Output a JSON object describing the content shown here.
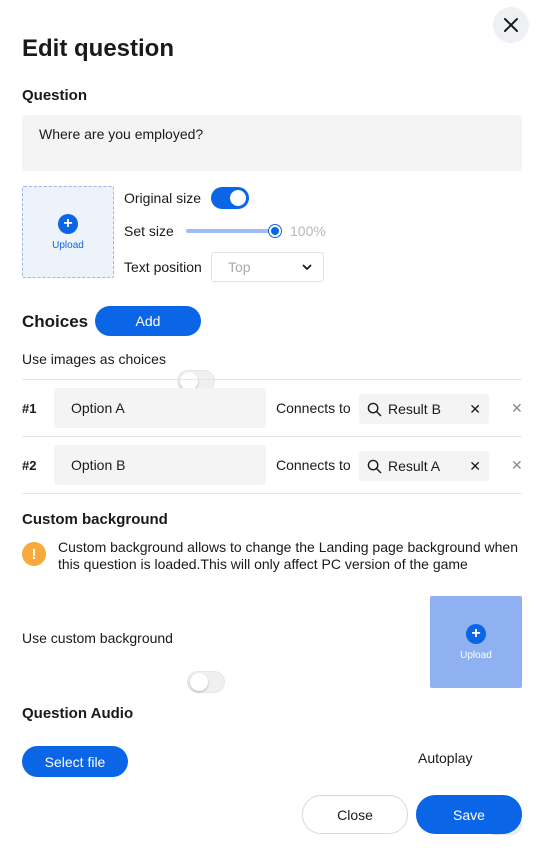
{
  "dialog": {
    "title": "Edit question"
  },
  "question": {
    "section_label": "Question",
    "text": "Where are you employed?"
  },
  "media": {
    "upload_label": "Upload",
    "original_size_label": "Original size",
    "original_size_on": true,
    "set_size_label": "Set size",
    "set_size_value": "100%",
    "text_position_label": "Text position",
    "text_position_value": "Top"
  },
  "choices": {
    "section_label": "Choices",
    "add_label": "Add",
    "use_images_label": "Use images as choices",
    "use_images_on": false,
    "connects_label": "Connects to",
    "items": [
      {
        "num": "#1",
        "value": "Option A",
        "connects_to": "Result B"
      },
      {
        "num": "#2",
        "value": "Option B",
        "connects_to": "Result A"
      }
    ]
  },
  "background": {
    "section_label": "Custom background",
    "info": "Custom background allows to change the Landing page background when this question is loaded.This will only affect PC version of the game",
    "use_label": "Use custom background",
    "use_on": false,
    "upload_label": "Upload"
  },
  "audio": {
    "section_label": "Question Audio",
    "select_file_label": "Select file",
    "autoplay_label": "Autoplay",
    "autoplay_on": false
  },
  "footer": {
    "close_label": "Close",
    "save_label": "Save"
  },
  "colors": {
    "accent": "#0a66e6",
    "info": "#f7a93b",
    "field_bg": "#f4f4f5"
  }
}
